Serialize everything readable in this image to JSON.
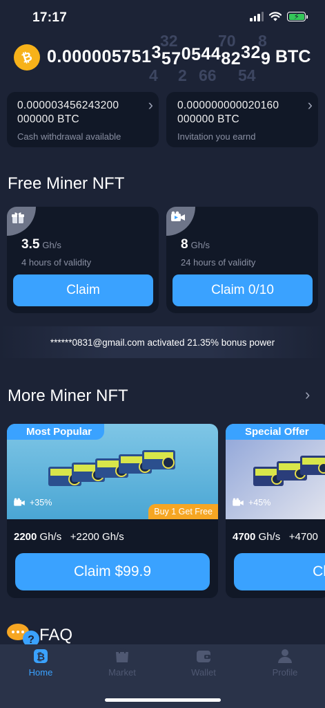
{
  "status_bar": {
    "time": "17:17"
  },
  "balance": {
    "main": "0.000005751",
    "rolling": [
      "3",
      "5",
      "7",
      "0",
      "5",
      "4",
      "4",
      "8",
      "2",
      "3",
      "2",
      "9"
    ],
    "ghost_top": [
      "32",
      "70",
      "8"
    ],
    "ghost_bottom": [
      "4",
      "2",
      "66",
      "54"
    ],
    "unit": "BTC"
  },
  "cards": [
    {
      "value_line1": "0.000003456243200",
      "value_line2": "000000  BTC",
      "label": "Cash withdrawal available"
    },
    {
      "value_line1": "0.000000000020160",
      "value_line2": "000000  BTC",
      "label": "Invitation you earnd"
    }
  ],
  "free_section": {
    "title": "Free Miner NFT"
  },
  "free_nfts": [
    {
      "power": "3.5",
      "unit": "Gh/s",
      "validity": "4 hours of validity",
      "button": "Claim",
      "icon": "gift-icon"
    },
    {
      "power": "8",
      "unit": "Gh/s",
      "validity": "24 hours of validity",
      "button": "Claim 0/10",
      "icon": "video-icon"
    }
  ],
  "banner": {
    "text": "******0831@gmail.com activated 21.35% bonus power"
  },
  "more_section": {
    "title": "More Miner NFT"
  },
  "miners": [
    {
      "tag": "Most Popular",
      "boost": "+35%",
      "promo": "Buy 1 Get Free",
      "power": "2200",
      "unit": "Gh/s",
      "bonus": "+2200  Gh/s",
      "button": "Claim $99.9"
    },
    {
      "tag": "Special Offer",
      "boost": "+45%",
      "power": "4700",
      "unit": "Gh/s",
      "bonus": "+4700",
      "button": "Claim"
    }
  ],
  "faq": {
    "title": "FAQ"
  },
  "tabbar": {
    "items": [
      {
        "label": "Home",
        "icon": "home-icon",
        "active": true
      },
      {
        "label": "Market",
        "icon": "market-icon",
        "active": false
      },
      {
        "label": "Wallet",
        "icon": "wallet-icon",
        "active": false
      },
      {
        "label": "Profile",
        "icon": "profile-icon",
        "active": false
      }
    ]
  },
  "colors": {
    "background": "#1c2336",
    "accent": "#3aa2ff",
    "card": "#111827",
    "promo": "#f6a623",
    "coin": "#f7b21a"
  }
}
